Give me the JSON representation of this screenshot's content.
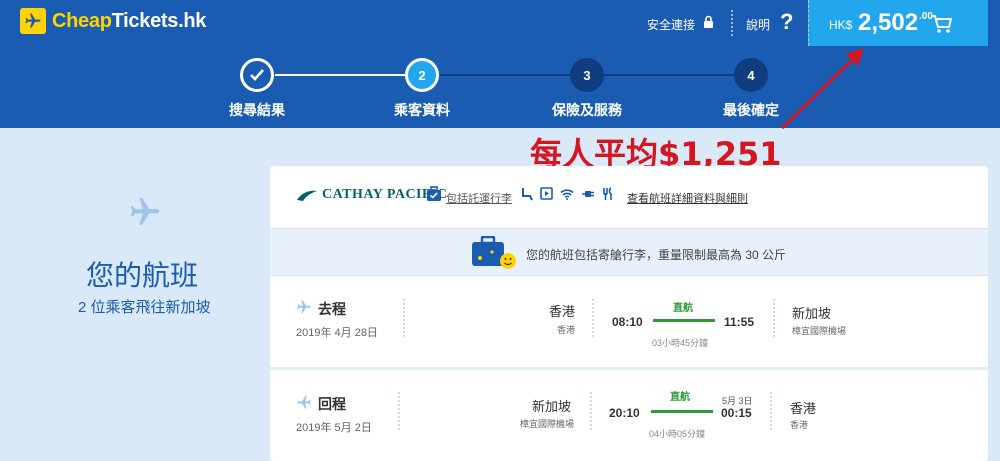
{
  "header": {
    "brand_part1": "Cheap",
    "brand_part2": "Tickets.hk",
    "secure_label": "安全連接",
    "help_label": "說明",
    "help_q": "?",
    "cart_currency": "HK$",
    "cart_amount": "2,502",
    "cart_cents": ".00"
  },
  "steps": [
    {
      "label": "搜尋結果",
      "number": "",
      "state": "done"
    },
    {
      "label": "乘客資料",
      "number": "2",
      "state": "current"
    },
    {
      "label": "保險及服務",
      "number": "3",
      "state": "upcoming"
    },
    {
      "label": "最後確定",
      "number": "4",
      "state": "upcoming"
    }
  ],
  "annotation": {
    "text": "每人平均$1,251",
    "color": "#d51520"
  },
  "summary": {
    "title": "您的航班",
    "subtitle": "2 位乘客飛往新加坡"
  },
  "card": {
    "airline": "CATHAY PACIFIC",
    "baggage_link": "包括託運行李",
    "details_link": "查看航班詳細資料與細則",
    "baggage_notice": "您的航班包括寄艙行李，重量限制最高為 30 公斤",
    "legs": [
      {
        "direction": "去程",
        "date": "2019年 4月 28日",
        "from_city": "香港",
        "from_airport": "香港",
        "depart_time": "08:10",
        "stops": "直航",
        "duration": "03小時45分鐘",
        "arrive_time": "11:55",
        "arrive_date": "",
        "to_city": "新加坡",
        "to_airport": "樟宜國際機場"
      },
      {
        "direction": "回程",
        "date": "2019年 5月 2日",
        "from_city": "新加坡",
        "from_airport": "樟宜國際機場",
        "depart_time": "20:10",
        "stops": "直航",
        "duration": "04小時05分鐘",
        "arrive_time": "00:15",
        "arrive_date": "5月 3日",
        "to_city": "香港",
        "to_airport": "香港"
      }
    ]
  },
  "colors": {
    "brand_blue": "#1a5cb1",
    "cart_blue": "#22a6ee",
    "accent_yellow": "#ffd200",
    "nonstop_green": "#2e9a3a"
  }
}
